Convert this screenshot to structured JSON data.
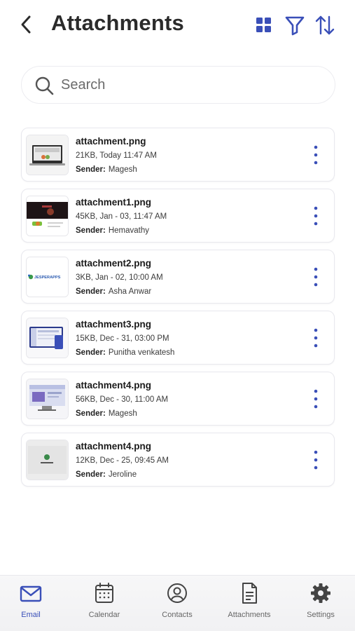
{
  "header": {
    "title": "Attachments"
  },
  "search": {
    "placeholder": "Search"
  },
  "attachments": [
    {
      "name": "attachment.png",
      "meta": "21KB, Today 11:47 AM",
      "sender_label": "Sender:",
      "sender": "Magesh"
    },
    {
      "name": "attachment1.png",
      "meta": "45KB, Jan - 03,  11:47 AM",
      "sender_label": "Sender:",
      "sender": "Hemavathy"
    },
    {
      "name": "attachment2.png",
      "meta": "3KB, Jan - 02,  10:00 AM",
      "sender_label": "Sender:",
      "sender": "Asha Anwar"
    },
    {
      "name": "attachment3.png",
      "meta": "15KB, Dec - 31, 03:00 PM",
      "sender_label": "Sender:",
      "sender": "Punitha venkatesh"
    },
    {
      "name": "attachment4.png",
      "meta": "56KB, Dec - 30,  11:00 AM",
      "sender_label": "Sender:",
      "sender": "Magesh"
    },
    {
      "name": "attachment4.png",
      "meta": "12KB, Dec - 25,  09:45 AM",
      "sender_label": "Sender:",
      "sender": "Jeroline"
    }
  ],
  "thumb2_text": "JESPERAPPS",
  "nav": {
    "email": "Email",
    "calendar": "Calendar",
    "contacts": "Contacts",
    "attachments": "Attachments",
    "settings": "Settings",
    "active": "email"
  },
  "colors": {
    "accent": "#3a4fb8",
    "icon_dark": "#444444"
  }
}
